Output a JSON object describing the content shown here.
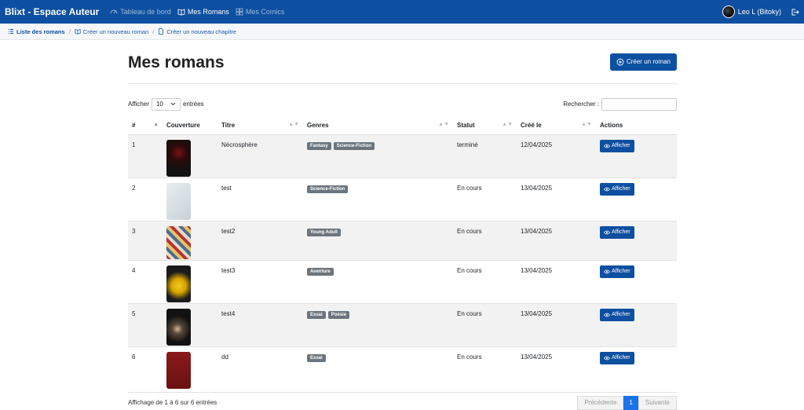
{
  "nav": {
    "brand": "Blixt - Espace Auteur",
    "items": [
      {
        "label": "Tableau de bord",
        "icon": "speedometer-icon",
        "active": false
      },
      {
        "label": "Mes Romans",
        "icon": "book-icon",
        "active": true
      },
      {
        "label": "Mes Comics",
        "icon": "grid-icon",
        "active": false
      }
    ],
    "user": "Leo L (Bitoky)",
    "logout_icon": "logout-icon"
  },
  "breadcrumb": [
    {
      "label": "Liste des romans",
      "icon": "list-icon"
    },
    {
      "label": "Créer un nouveau roman",
      "icon": "book-icon"
    },
    {
      "label": "Créer un nouveau chapitre",
      "icon": "file-icon"
    }
  ],
  "page": {
    "title": "Mes romans",
    "create_button": "Créer un roman"
  },
  "table_controls": {
    "show_label": "Afficher",
    "show_value": "10",
    "entries_label": "entrées",
    "search_label": "Rechercher :"
  },
  "table": {
    "columns": [
      "#",
      "Couverture",
      "Titre",
      "Genres",
      "Statut",
      "Créé le",
      "Actions"
    ],
    "rows": [
      {
        "num": "1",
        "title": "Nécrosphère",
        "genres": [
          "Fantasy",
          "Science-Fiction"
        ],
        "status": "terminé",
        "created": "12/04/2025",
        "action": "Afficher"
      },
      {
        "num": "2",
        "title": "test",
        "genres": [
          "Science-Fiction"
        ],
        "status": "En cours",
        "created": "13/04/2025",
        "action": "Afficher"
      },
      {
        "num": "3",
        "title": "test2",
        "genres": [
          "Young Adult"
        ],
        "status": "En cours",
        "created": "13/04/2025",
        "action": "Afficher"
      },
      {
        "num": "4",
        "title": "test3",
        "genres": [
          "Aventure"
        ],
        "status": "En cours",
        "created": "13/04/2025",
        "action": "Afficher"
      },
      {
        "num": "5",
        "title": "test4",
        "genres": [
          "Essai",
          "Poésie"
        ],
        "status": "En cours",
        "created": "13/04/2025",
        "action": "Afficher"
      },
      {
        "num": "6",
        "title": "dd",
        "genres": [
          "Essai"
        ],
        "status": "En cours",
        "created": "13/04/2025",
        "action": "Afficher"
      }
    ]
  },
  "footer": {
    "info": "Affichage de 1 à 6 sur 6 entrées",
    "prev": "Précédente",
    "current": "1",
    "next": "Suivante"
  },
  "colors": {
    "navbar": "#0d4fa0",
    "primary": "#0d4fa0",
    "badge": "#6c757d"
  }
}
